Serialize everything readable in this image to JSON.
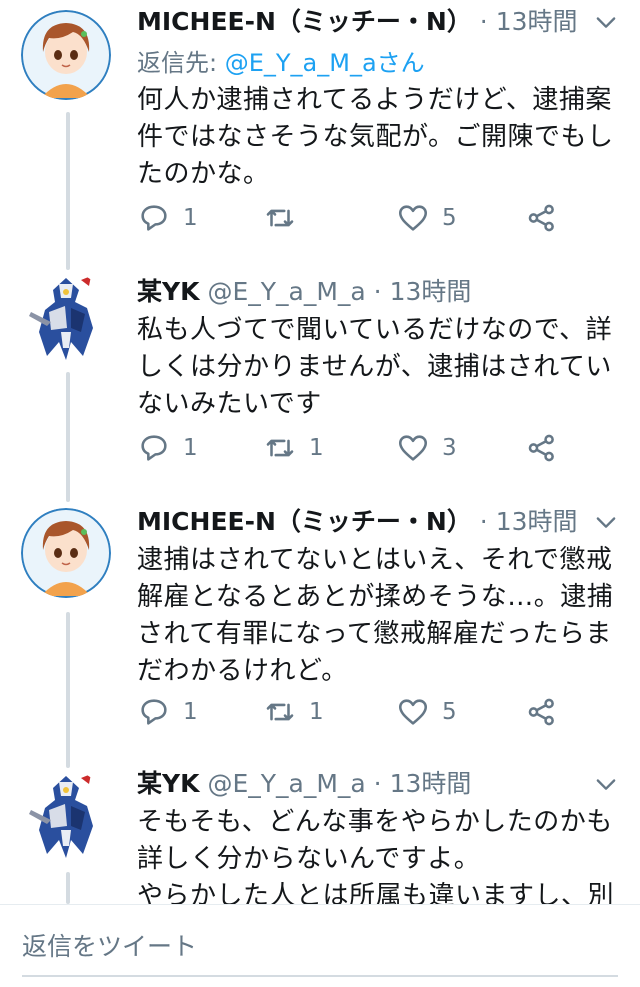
{
  "tweets": [
    {
      "name": "MICHEE-N（ミッチー・N）",
      "handle": "",
      "time": "13時間",
      "reply_to_prefix": "返信先: ",
      "reply_to_user": "@E_Y_a_M_aさん",
      "lines": [
        "何人か逮捕されてるようだけど、逮捕案",
        "件ではなさそうな気配が。ご開陳でもし",
        "たのかな。"
      ],
      "replies": "1",
      "retweets": "",
      "likes": "5"
    },
    {
      "name": "某YK",
      "handle": "@E_Y_a_M_a",
      "time": "13時間",
      "lines": [
        "私も人づてで聞いているだけなので、詳",
        "しくは分かりませんが、逮捕はされてい",
        "ないみたいです"
      ],
      "replies": "1",
      "retweets": "1",
      "likes": "3"
    },
    {
      "name": "MICHEE-N（ミッチー・N）",
      "handle": "",
      "time": "13時間",
      "lines": [
        "逮捕はされてないとはいえ、それで懲戒",
        "解雇となるとあとが揉めそうな…。逮捕",
        "されて有罪になって懲戒解雇だったらま",
        "だわかるけれど。"
      ],
      "replies": "1",
      "retweets": "1",
      "likes": "5"
    },
    {
      "name": "某YK",
      "handle": "@E_Y_a_M_a",
      "time": "13時間",
      "lines": [
        "そもそも、どんな事をやらかしたのかも",
        "詳しく分からないんですよ。",
        "やらかした人とは所属も違いますし、別"
      ]
    }
  ],
  "separator": "·",
  "reply_box": {
    "placeholder": "返信をツイート"
  },
  "colors": {
    "text": "#14171a",
    "secondary": "#657786",
    "accent": "#1da1f2",
    "thread": "#d4dbe1"
  },
  "icons": {
    "reply": "comment-icon",
    "retweet": "retweet-icon",
    "like": "heart-icon",
    "share": "share-icon",
    "menu": "chevron-down-icon"
  }
}
